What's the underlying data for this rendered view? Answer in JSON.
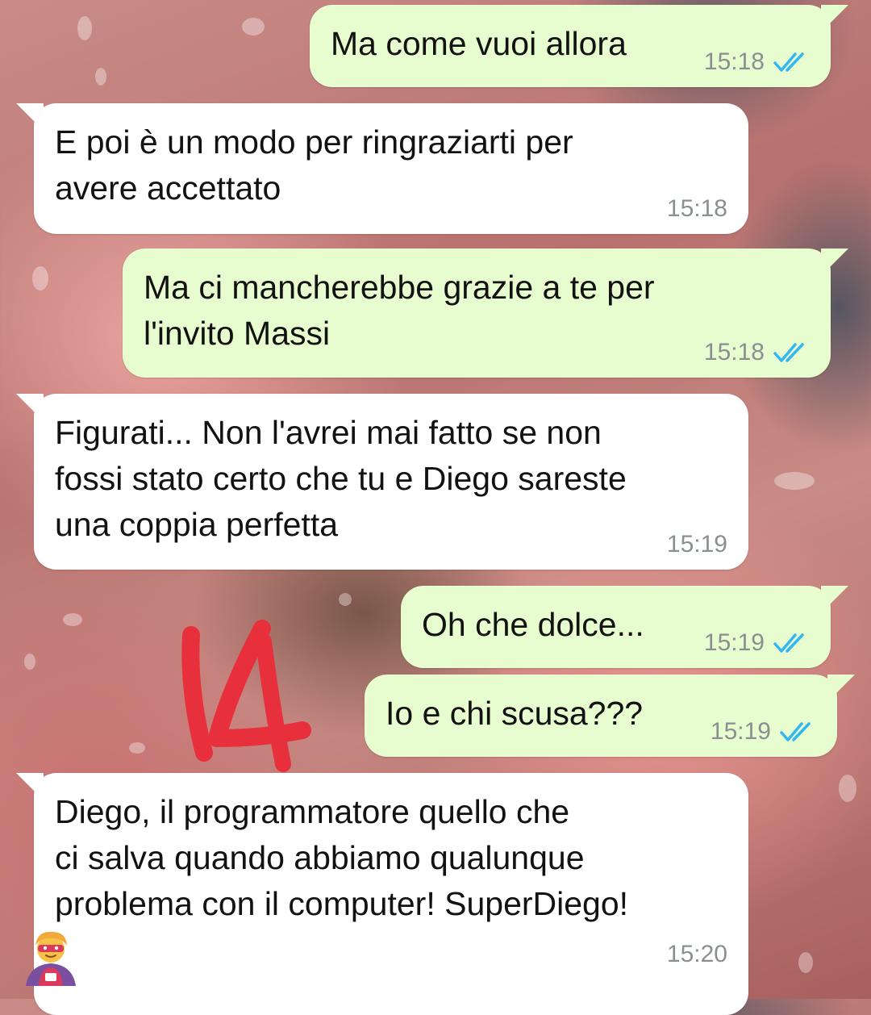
{
  "messages": [
    {
      "dir": "out",
      "text": "Ma come vuoi allora",
      "time": "15:18",
      "status": "read"
    },
    {
      "dir": "in",
      "text": "E poi è un modo per ringraziarti per\navere accettato",
      "time": "15:18"
    },
    {
      "dir": "out",
      "text": "Ma ci mancherebbe grazie a te per\nl'invito Massi",
      "time": "15:18",
      "status": "read"
    },
    {
      "dir": "in",
      "text": "Figurati... Non l'avrei mai fatto se non\nfossi stato certo che tu e Diego sareste\nuna coppia perfetta",
      "time": "15:19"
    },
    {
      "dir": "out",
      "text": "Oh che dolce...",
      "time": "15:19",
      "status": "read"
    },
    {
      "dir": "out",
      "text": "Io e chi scusa???",
      "time": "15:19",
      "status": "read"
    },
    {
      "dir": "in",
      "text": "Diego, il programmatore quello che\nci salva quando abbiamo qualunque\nproblema con il computer! SuperDiego!",
      "time": "15:20",
      "emoji": "superhero-emoji"
    }
  ],
  "annotation": {
    "text": "14",
    "color": "#e8303c"
  },
  "colors": {
    "incoming": "#ffffff",
    "outgoing": "#e7fccf",
    "tick": "#34b7f1",
    "time": "#8a8f92"
  }
}
